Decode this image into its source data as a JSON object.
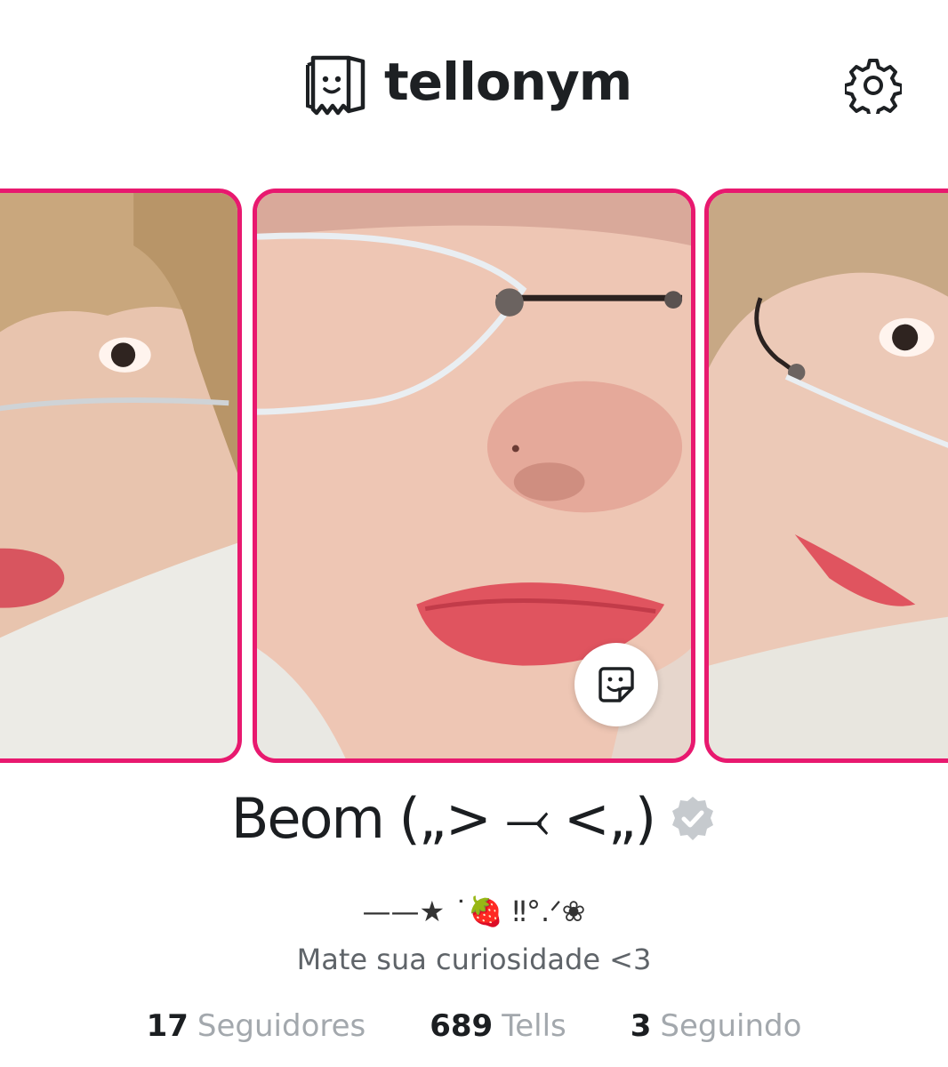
{
  "header": {
    "brand_name": "tellonym",
    "logo_icon": "paper-bag-face-icon",
    "settings_icon": "gear-icon"
  },
  "carousel": {
    "accent_color": "#e8196f",
    "photos": [
      {
        "position": "left",
        "description_icon": "profile-photo"
      },
      {
        "position": "center",
        "description_icon": "profile-photo"
      },
      {
        "position": "right",
        "description_icon": "profile-photo"
      }
    ],
    "sticker_icon": "sticker-smile-icon"
  },
  "profile": {
    "name": "Beom („> ⤙ <„)",
    "verified_icon": "verified-badge-icon",
    "bio_line1": "——★ ˙🍓 ‼°.ᐟ❀",
    "bio_line2": "Mate sua curiosidade <3"
  },
  "stats": [
    {
      "value": "17",
      "label": "Seguidores"
    },
    {
      "value": "689",
      "label": "Tells"
    },
    {
      "value": "3",
      "label": "Seguindo"
    }
  ]
}
